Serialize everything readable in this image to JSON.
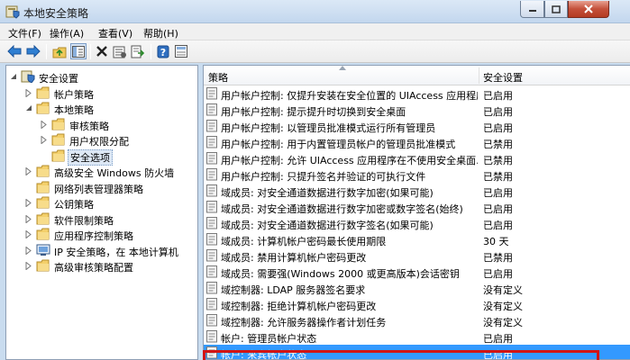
{
  "window": {
    "title": "本地安全策略"
  },
  "menu": [
    "文件(F)",
    "操作(A)",
    "查看(V)",
    "帮助(H)"
  ],
  "toolbar": {
    "icons": [
      "back-arrow-icon",
      "forward-arrow-icon",
      "up-folder-icon",
      "show-tree-icon",
      "delete-icon",
      "properties-icon",
      "refresh-icon",
      "export-icon",
      "help-icon",
      "view-icon"
    ]
  },
  "tree": [
    {
      "label": "安全设置",
      "depth": 0,
      "expanded": true
    },
    {
      "label": "帐户策略",
      "depth": 1,
      "expanded": false
    },
    {
      "label": "本地策略",
      "depth": 1,
      "expanded": true
    },
    {
      "label": "审核策略",
      "depth": 2,
      "expanded": false
    },
    {
      "label": "用户权限分配",
      "depth": 2,
      "expanded": false
    },
    {
      "label": "安全选项",
      "depth": 2,
      "expanded": null,
      "selected": true
    },
    {
      "label": "高级安全 Windows 防火墙",
      "depth": 1,
      "expanded": false
    },
    {
      "label": "网络列表管理器策略",
      "depth": 1,
      "expanded": null
    },
    {
      "label": "公钥策略",
      "depth": 1,
      "expanded": false
    },
    {
      "label": "软件限制策略",
      "depth": 1,
      "expanded": false
    },
    {
      "label": "应用程序控制策略",
      "depth": 1,
      "expanded": false
    },
    {
      "label": "IP 安全策略，在 本地计算机",
      "depth": 1,
      "expanded": false
    },
    {
      "label": "高级审核策略配置",
      "depth": 1,
      "expanded": false
    }
  ],
  "list": {
    "columns": {
      "policy": "策略",
      "setting": "安全设置"
    },
    "rows": [
      {
        "policy": "用户帐户控制: 仅提升安装在安全位置的 UIAccess 应用程序",
        "setting": "已启用"
      },
      {
        "policy": "用户帐户控制: 提示提升时切换到安全桌面",
        "setting": "已启用"
      },
      {
        "policy": "用户帐户控制: 以管理员批准模式运行所有管理员",
        "setting": "已启用"
      },
      {
        "policy": "用户帐户控制: 用于内置管理员帐户的管理员批准模式",
        "setting": "已禁用"
      },
      {
        "policy": "用户帐户控制: 允许 UIAccess 应用程序在不使用安全桌面...",
        "setting": "已禁用"
      },
      {
        "policy": "用户帐户控制: 只提升签名并验证的可执行文件",
        "setting": "已禁用"
      },
      {
        "policy": "域成员: 对安全通道数据进行数字加密(如果可能)",
        "setting": "已启用"
      },
      {
        "policy": "域成员: 对安全通道数据进行数字加密或数字签名(始终)",
        "setting": "已启用"
      },
      {
        "policy": "域成员: 对安全通道数据进行数字签名(如果可能)",
        "setting": "已启用"
      },
      {
        "policy": "域成员: 计算机帐户密码最长使用期限",
        "setting": "30 天"
      },
      {
        "policy": "域成员: 禁用计算机帐户密码更改",
        "setting": "已禁用"
      },
      {
        "policy": "域成员: 需要强(Windows 2000 或更高版本)会话密钥",
        "setting": "已启用"
      },
      {
        "policy": "域控制器: LDAP 服务器签名要求",
        "setting": "没有定义"
      },
      {
        "policy": "域控制器: 拒绝计算机帐户密码更改",
        "setting": "没有定义"
      },
      {
        "policy": "域控制器: 允许服务器操作者计划任务",
        "setting": "没有定义"
      },
      {
        "policy": "帐户: 管理员帐户状态",
        "setting": "已启用"
      },
      {
        "policy": "帐户: 来宾帐户状态",
        "setting": "已启用",
        "selected": true
      }
    ]
  }
}
